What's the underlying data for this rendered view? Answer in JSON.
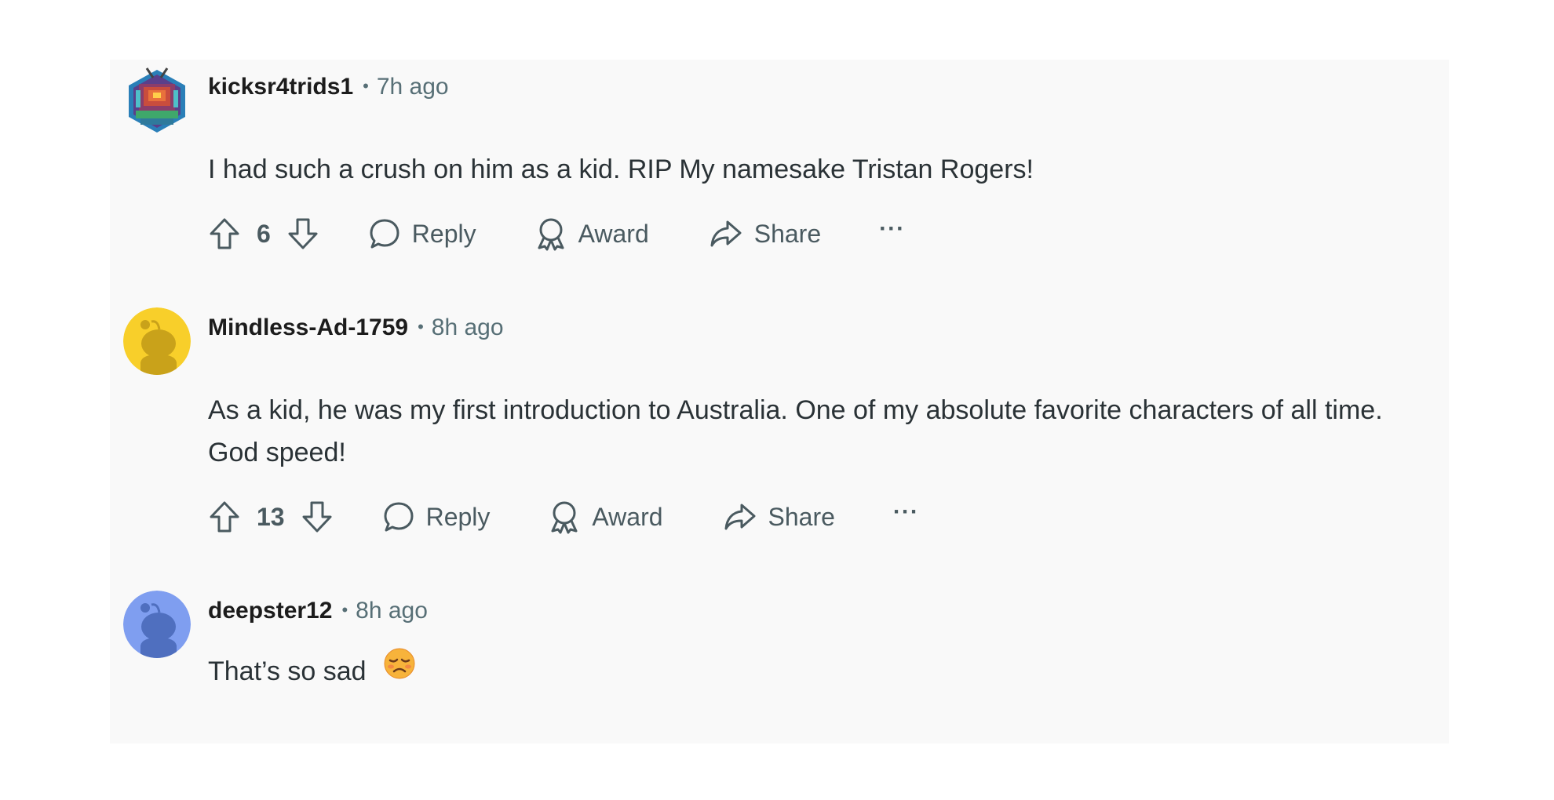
{
  "comments": [
    {
      "username": "kicksr4trids1",
      "separator": "•",
      "time": "7h ago",
      "body": "I had such a crush on him as a kid. RIP My namesake Tristan Rogers!",
      "votes": "6",
      "avatar_icon": "pixel-art-avatar-icon"
    },
    {
      "username": "Mindless-Ad-1759",
      "separator": "•",
      "time": "8h ago",
      "body": "As a kid, he was my first introduction to Australia. One of my absolute favorite characters of all time. God speed!",
      "votes": "13",
      "avatar_icon": "snoo-avatar-yellow-icon"
    },
    {
      "username": "deepster12",
      "separator": "•",
      "time": "8h ago",
      "body": "That’s so sad",
      "emoji": "disappointed-face-icon",
      "avatar_icon": "snoo-avatar-blue-icon"
    }
  ],
  "actions": {
    "reply": "Reply",
    "award": "Award",
    "share": "Share",
    "more": "···"
  },
  "colors": {
    "panel_bg": "#f9f9f9",
    "meta_gray": "#576f76",
    "yellow_avatar": "#f8cf2a",
    "blue_avatar": "#7f9ef0"
  }
}
